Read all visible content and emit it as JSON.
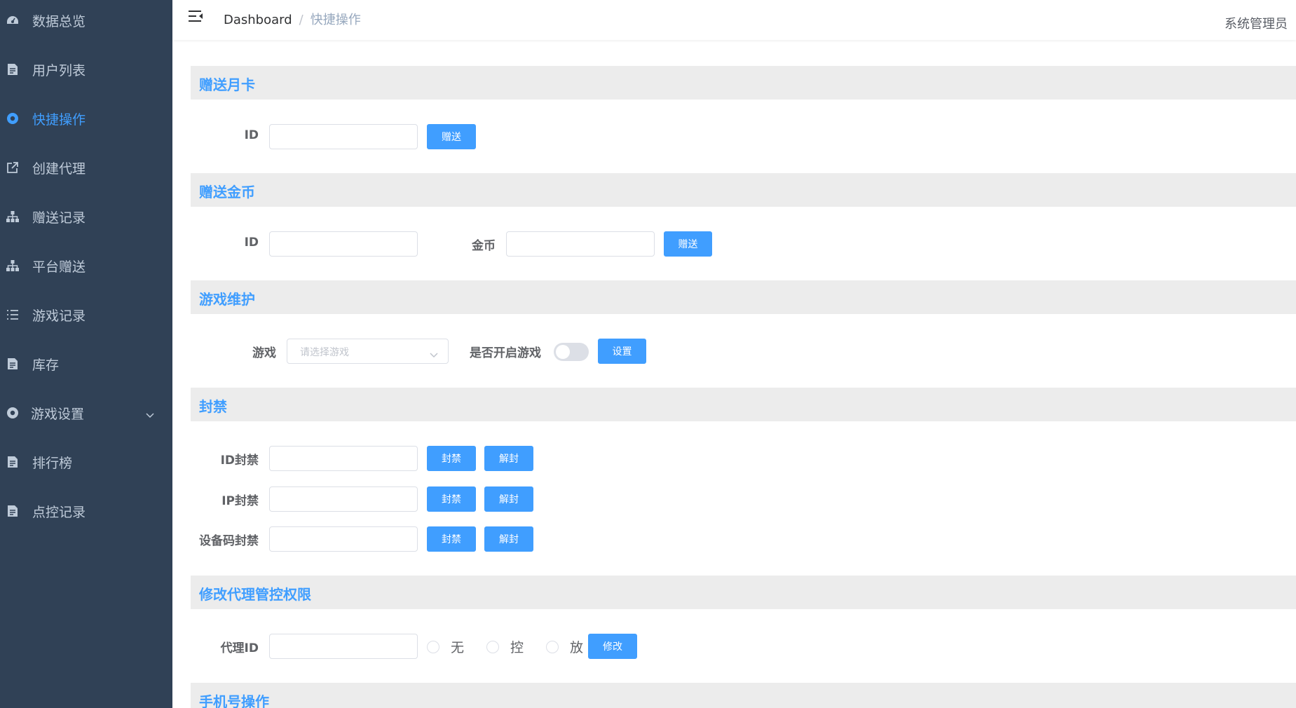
{
  "sidebar": {
    "items": [
      {
        "label": "数据总览",
        "icon": "dashboard-icon"
      },
      {
        "label": "用户列表",
        "icon": "document-icon"
      },
      {
        "label": "快捷操作",
        "icon": "circle-icon"
      },
      {
        "label": "创建代理",
        "icon": "external-link-icon"
      },
      {
        "label": "赠送记录",
        "icon": "tree-icon"
      },
      {
        "label": "平台赠送",
        "icon": "tree-icon"
      },
      {
        "label": "游戏记录",
        "icon": "list-icon"
      },
      {
        "label": "库存",
        "icon": "document-icon"
      },
      {
        "label": "游戏设置",
        "icon": "circle-icon"
      },
      {
        "label": "排行榜",
        "icon": "document-icon"
      },
      {
        "label": "点控记录",
        "icon": "document-icon"
      }
    ],
    "active_index": 2
  },
  "header": {
    "breadcrumb_home": "Dashboard",
    "breadcrumb_sep": "/",
    "breadcrumb_current": "快捷操作",
    "user": "系统管理员"
  },
  "sections": {
    "monthly_card": {
      "title": "赠送月卡",
      "id_label": "ID",
      "send_button": "赠送"
    },
    "gold": {
      "title": "赠送金币",
      "id_label": "ID",
      "gold_label": "金币",
      "send_button": "赠送"
    },
    "game_maintenance": {
      "title": "游戏维护",
      "game_label": "游戏",
      "game_placeholder": "请选择游戏",
      "enable_label": "是否开启游戏",
      "enabled": false,
      "set_button": "设置"
    },
    "ban": {
      "title": "封禁",
      "rows": [
        {
          "label": "ID封禁",
          "ban_button": "封禁",
          "unban_button": "解封"
        },
        {
          "label": "IP封禁",
          "ban_button": "封禁",
          "unban_button": "解封"
        },
        {
          "label": "设备码封禁",
          "ban_button": "封禁",
          "unban_button": "解封"
        }
      ]
    },
    "agent_permission": {
      "title": "修改代理管控权限",
      "agent_label": "代理ID",
      "options": [
        "无",
        "控",
        "放"
      ],
      "modify_button": "修改"
    },
    "phone": {
      "title": "手机号操作"
    }
  },
  "colors": {
    "sidebar_bg": "#304156",
    "sidebar_text": "#bfcbd9",
    "accent": "#409eff",
    "section_bg": "#ececec"
  }
}
